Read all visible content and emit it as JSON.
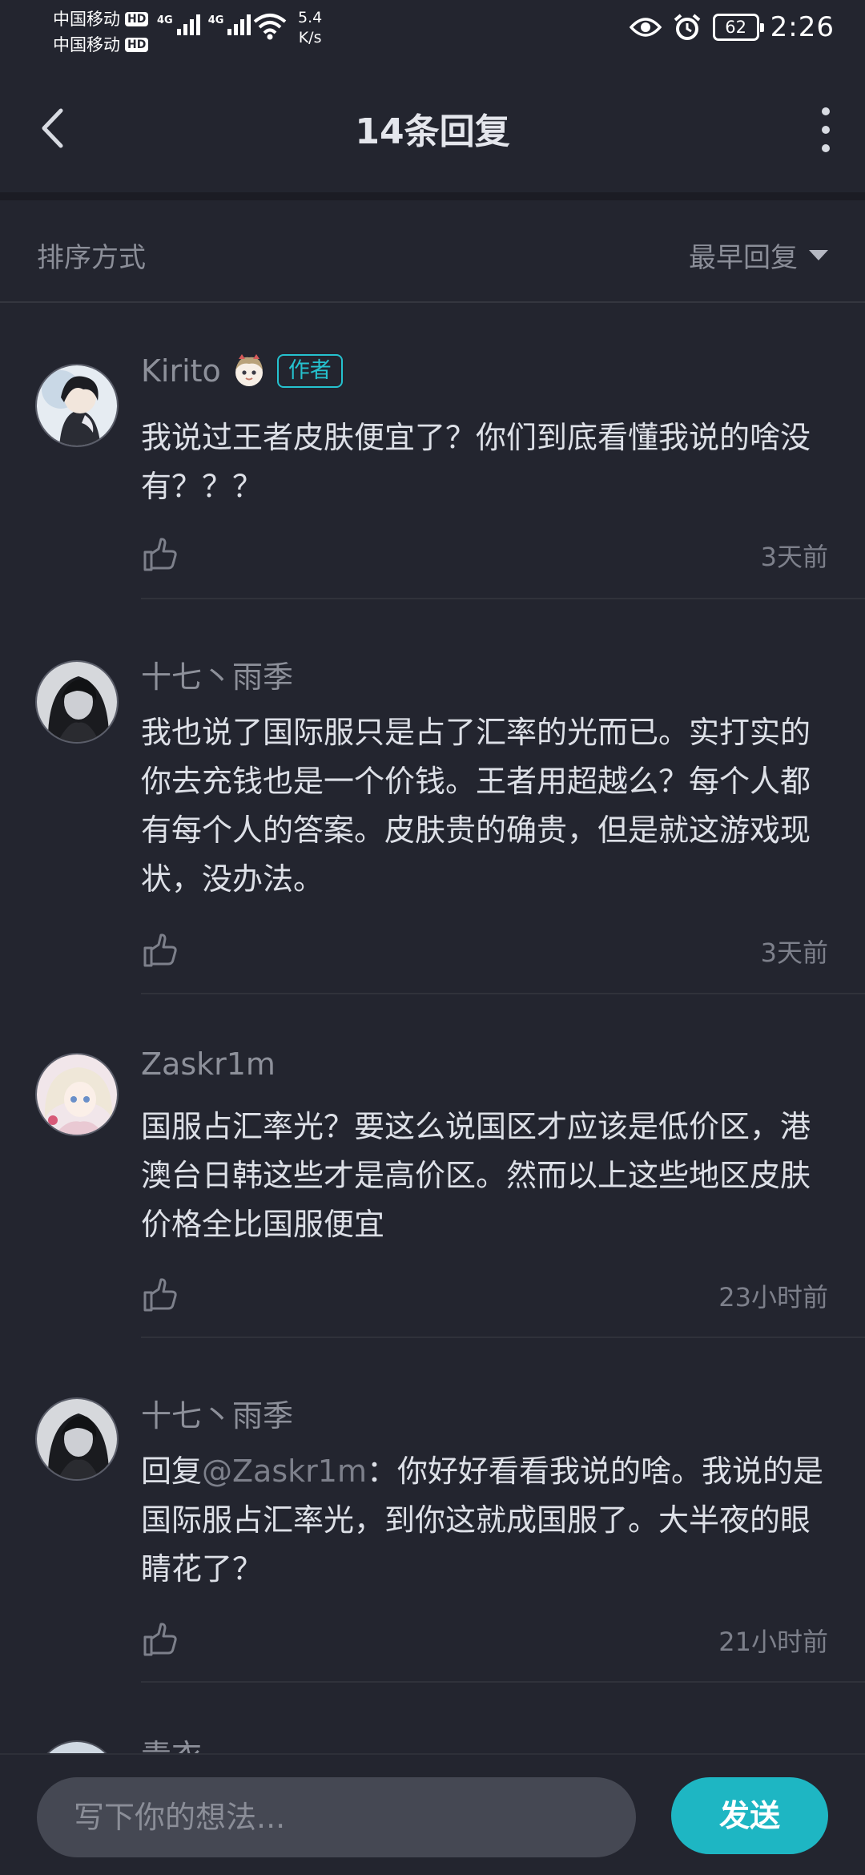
{
  "status": {
    "carrier1": "中国移动",
    "carrier2": "中国移动",
    "hd": "HD",
    "net_tag1": "4G",
    "net_tag2": "4G",
    "speed_value": "5.4",
    "speed_unit": "K/s",
    "battery": "62",
    "time": "2:26"
  },
  "header": {
    "title": "14条回复"
  },
  "sort": {
    "label": "排序方式",
    "selected": "最早回复"
  },
  "comments": [
    {
      "user": "Kirito",
      "badge": "作者",
      "text": "我说过王者皮肤便宜了？你们到底看懂我说的啥没有？？？",
      "time": "3天前"
    },
    {
      "user": "十七丶雨季",
      "text": "我也说了国际服只是占了汇率的光而已。实打实的你去充钱也是一个价钱。王者用超越么？每个人都有每个人的答案。皮肤贵的确贵，但是就这游戏现状，没办法。",
      "time": "3天前"
    },
    {
      "user": "Zaskr1m",
      "text": "国服占汇率光？要这么说国区才应该是低价区，港澳台日韩这些才是高价区。然而以上这些地区皮肤价格全比国服便宜",
      "time": "23小时前"
    },
    {
      "user": "十七丶雨季",
      "reply_prefix": "回复",
      "mention": "@Zaskr1m",
      "text": "：你好好看看我说的啥。我说的是国际服占汇率光，到你这就成国服了。大半夜的眼睛花了？",
      "time": "21小时前"
    },
    {
      "user": "青衣"
    }
  ],
  "bottom": {
    "placeholder": "写下你的想法...",
    "send": "发送"
  },
  "colors": {
    "background": "#23252f",
    "accent": "#1eb6c3",
    "author_badge": "#25c2cf"
  }
}
